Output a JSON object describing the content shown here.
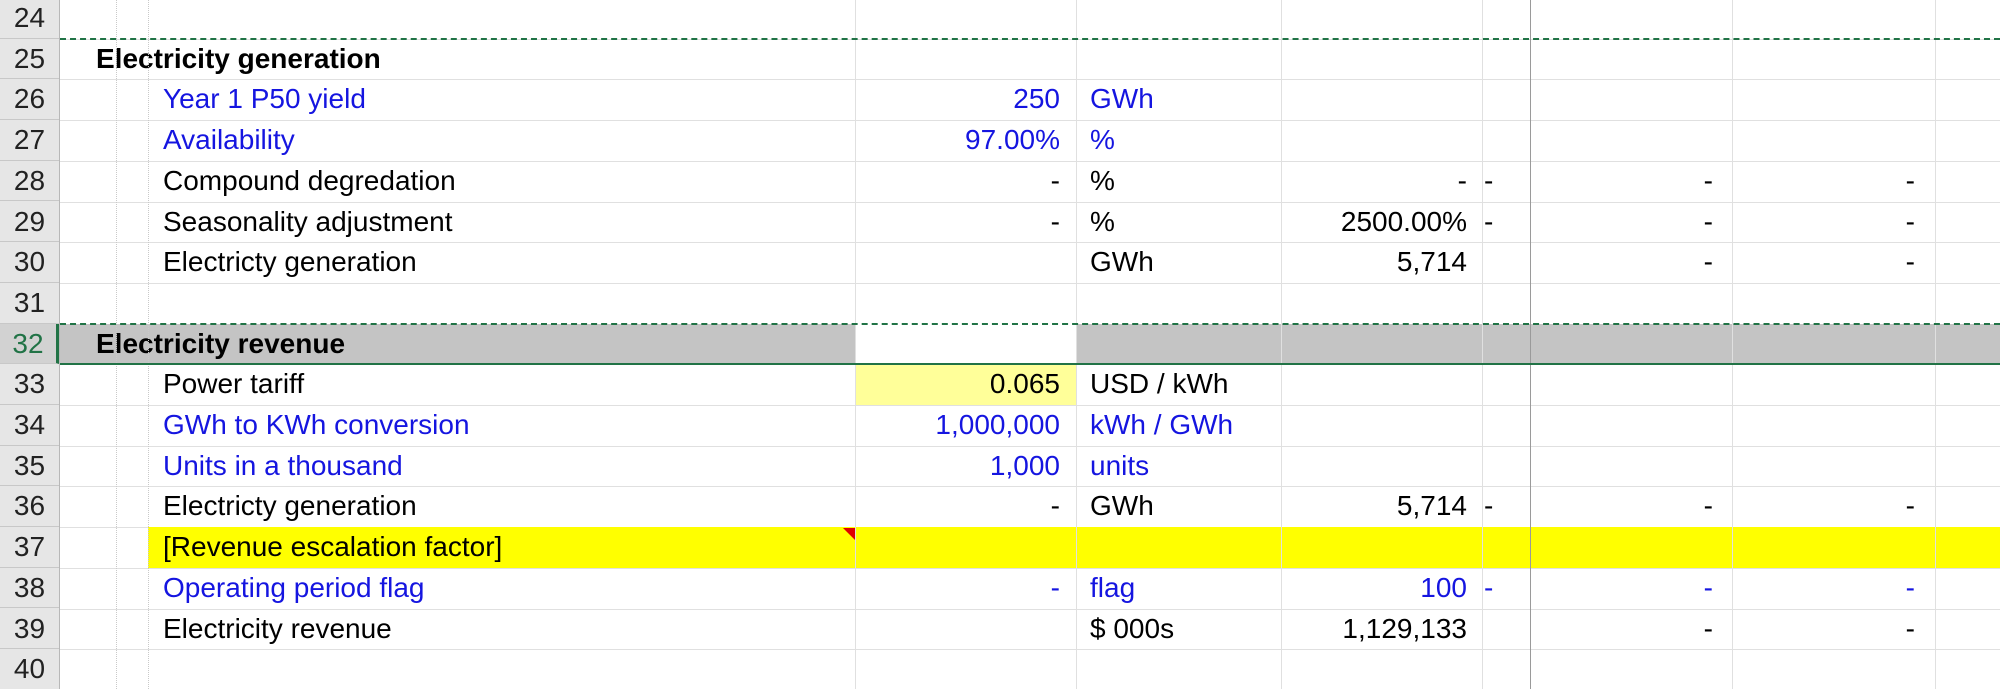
{
  "sheet": {
    "active_row": "32",
    "rows": [
      {
        "num": "24",
        "cells": []
      },
      {
        "num": "25",
        "cells": [
          {
            "col": "section",
            "text": "Electricity generation",
            "style": "bold"
          }
        ]
      },
      {
        "num": "26",
        "cells": [
          {
            "col": "label",
            "text": "Year 1 P50 yield",
            "style": "blue"
          },
          {
            "col": "value",
            "text": "250",
            "style": "blue"
          },
          {
            "col": "unit",
            "text": "GWh",
            "style": "blue"
          }
        ]
      },
      {
        "num": "27",
        "cells": [
          {
            "col": "label",
            "text": "Availability",
            "style": "blue"
          },
          {
            "col": "value",
            "text": "97.00%",
            "style": "blue"
          },
          {
            "col": "unit",
            "text": "%",
            "style": "blue"
          }
        ]
      },
      {
        "num": "28",
        "cells": [
          {
            "col": "label",
            "text": "Compound degredation",
            "style": "black"
          },
          {
            "col": "value",
            "text": "-",
            "style": "black"
          },
          {
            "col": "unit",
            "text": "%",
            "style": "black"
          },
          {
            "col": "total",
            "text": "-",
            "style": "black"
          },
          {
            "col": "p1",
            "text": "-",
            "style": "black"
          },
          {
            "col": "p2",
            "text": "-",
            "style": "black"
          },
          {
            "col": "p3",
            "text": "-",
            "style": "black"
          }
        ]
      },
      {
        "num": "29",
        "cells": [
          {
            "col": "label",
            "text": "Seasonality adjustment",
            "style": "black"
          },
          {
            "col": "value",
            "text": "-",
            "style": "black"
          },
          {
            "col": "unit",
            "text": "%",
            "style": "black"
          },
          {
            "col": "total",
            "text": "2500.00%",
            "style": "black"
          },
          {
            "col": "p1",
            "text": "-",
            "style": "black"
          },
          {
            "col": "p2",
            "text": "-",
            "style": "black"
          },
          {
            "col": "p3",
            "text": "-",
            "style": "black"
          }
        ]
      },
      {
        "num": "30",
        "cells": [
          {
            "col": "label",
            "text": "Electricty generation",
            "style": "black"
          },
          {
            "col": "unit",
            "text": "GWh",
            "style": "black"
          },
          {
            "col": "total",
            "text": "5,714",
            "style": "black"
          },
          {
            "col": "p2",
            "text": "-",
            "style": "black"
          },
          {
            "col": "p3",
            "text": "-",
            "style": "black"
          }
        ]
      },
      {
        "num": "31",
        "cells": []
      },
      {
        "num": "32",
        "fill": "grey",
        "cells": [
          {
            "col": "section",
            "text": "Electricity revenue",
            "style": "bold"
          }
        ]
      },
      {
        "num": "33",
        "cells": [
          {
            "col": "label",
            "text": "Power tariff",
            "style": "black"
          },
          {
            "col": "value",
            "text": "0.065",
            "style": "black",
            "fill": "#ffff99"
          },
          {
            "col": "unit",
            "text": "USD / kWh",
            "style": "black"
          }
        ]
      },
      {
        "num": "34",
        "cells": [
          {
            "col": "label",
            "text": "GWh to KWh conversion",
            "style": "blue"
          },
          {
            "col": "value",
            "text": "1,000,000",
            "style": "blue"
          },
          {
            "col": "unit",
            "text": "kWh / GWh",
            "style": "blue"
          }
        ]
      },
      {
        "num": "35",
        "cells": [
          {
            "col": "label",
            "text": "Units in a thousand",
            "style": "blue"
          },
          {
            "col": "value",
            "text": "1,000",
            "style": "blue"
          },
          {
            "col": "unit",
            "text": "units",
            "style": "blue"
          }
        ]
      },
      {
        "num": "36",
        "cells": [
          {
            "col": "label",
            "text": "Electricty generation",
            "style": "black"
          },
          {
            "col": "value",
            "text": "-",
            "style": "black"
          },
          {
            "col": "unit",
            "text": "GWh",
            "style": "black"
          },
          {
            "col": "total",
            "text": "5,714",
            "style": "black"
          },
          {
            "col": "p1",
            "text": "-",
            "style": "black"
          },
          {
            "col": "p2",
            "text": "-",
            "style": "black"
          },
          {
            "col": "p3",
            "text": "-",
            "style": "black"
          }
        ]
      },
      {
        "num": "37",
        "fill": "yellow",
        "comment": true,
        "cells": [
          {
            "col": "label",
            "text": "[Revenue escalation factor]",
            "style": "black"
          }
        ]
      },
      {
        "num": "38",
        "cells": [
          {
            "col": "label",
            "text": "Operating period flag",
            "style": "blue"
          },
          {
            "col": "value",
            "text": "-",
            "style": "blue"
          },
          {
            "col": "unit",
            "text": "flag",
            "style": "blue"
          },
          {
            "col": "total",
            "text": "100",
            "style": "blue"
          },
          {
            "col": "p1",
            "text": "-",
            "style": "blue"
          },
          {
            "col": "p2",
            "text": "-",
            "style": "blue"
          },
          {
            "col": "p3",
            "text": "-",
            "style": "blue"
          }
        ]
      },
      {
        "num": "39",
        "cells": [
          {
            "col": "label",
            "text": "Electricity revenue",
            "style": "black"
          },
          {
            "col": "unit",
            "text": "$ 000s",
            "style": "black"
          },
          {
            "col": "total",
            "text": "1,129,133",
            "style": "black"
          },
          {
            "col": "p2",
            "text": "-",
            "style": "black"
          },
          {
            "col": "p3",
            "text": "-",
            "style": "black"
          }
        ]
      },
      {
        "num": "40",
        "cells": []
      }
    ]
  },
  "colors": {
    "input_blue": "#1515e0",
    "section_grey": "#c4c4c4",
    "highlight_yellow": "#ffff00",
    "input_cell_yellow": "#ffff99",
    "selection_green": "#217346"
  }
}
